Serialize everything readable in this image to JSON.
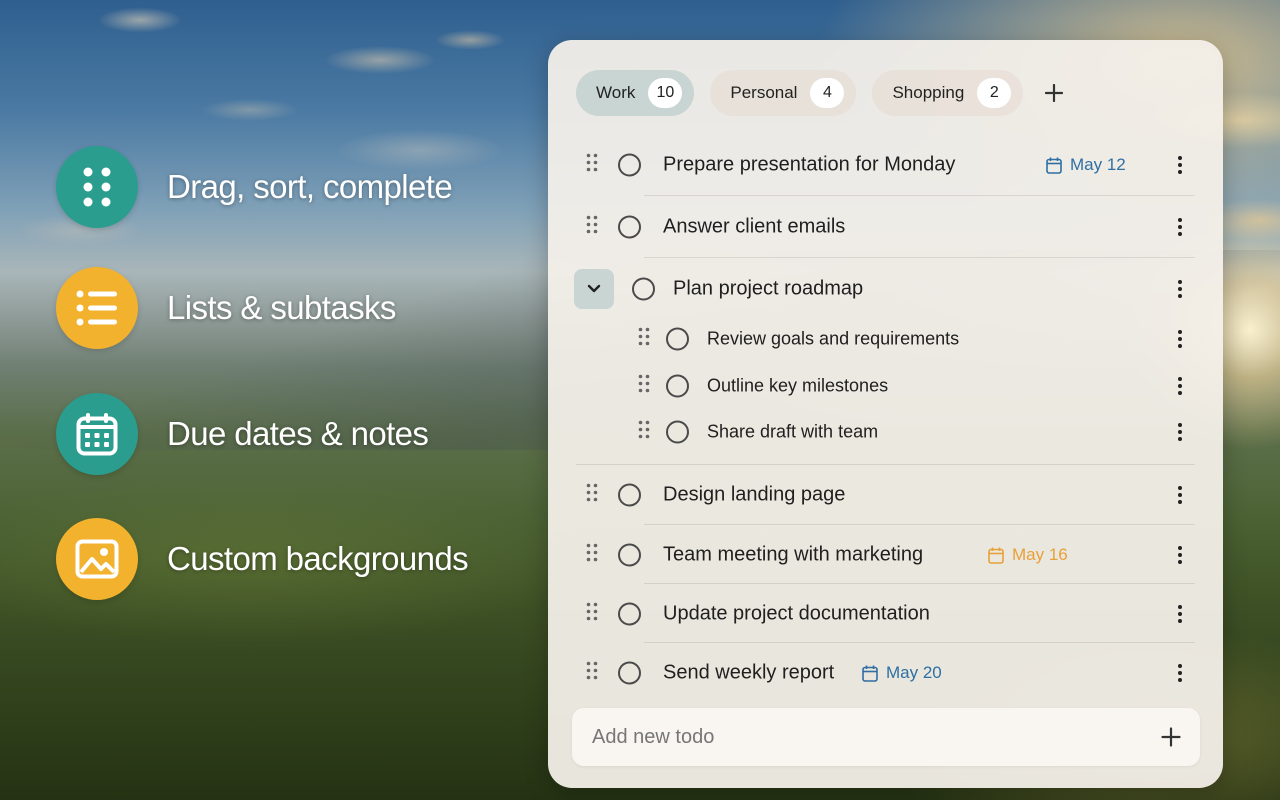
{
  "features": [
    {
      "label": "Drag, sort, complete",
      "icon": "drag-dots-icon",
      "color": "#2a9d8f"
    },
    {
      "label": "Lists & subtasks",
      "icon": "list-icon",
      "color": "#f2b22e"
    },
    {
      "label": "Due dates & notes",
      "icon": "calendar-icon",
      "color": "#2a9d8f"
    },
    {
      "label": "Custom backgrounds",
      "icon": "image-icon",
      "color": "#f2b22e"
    }
  ],
  "tabs": [
    {
      "label": "Work",
      "count": "10",
      "active": true
    },
    {
      "label": "Personal",
      "count": "4",
      "active": false
    },
    {
      "label": "Shopping",
      "count": "2",
      "active": false
    }
  ],
  "tasks": [
    {
      "text": "Prepare presentation for Monday",
      "date": "May 12",
      "date_color": "#2f6fa3"
    },
    {
      "text": "Answer client emails"
    },
    {
      "text": "Plan project roadmap",
      "expanded": true
    },
    {
      "text": "Review goals and requirements",
      "subtask": true
    },
    {
      "text": "Outline key milestones",
      "subtask": true
    },
    {
      "text": "Share draft with team",
      "subtask": true
    },
    {
      "text": "Design landing page"
    },
    {
      "text": "Team meeting with marketing",
      "date": "May 16",
      "date_color": "#e8a13a"
    },
    {
      "text": "Update project documentation"
    },
    {
      "text": "Send weekly report",
      "date": "May 20",
      "date_color": "#2f6fa3"
    }
  ],
  "add_todo": {
    "placeholder": "Add new todo",
    "value": ""
  },
  "colors": {
    "accent_teal": "#2a9d8f",
    "accent_amber": "#f2b22e",
    "active_tab": "#c9d5d3",
    "date_blue": "#2f6fa3",
    "date_orange": "#e8a13a"
  }
}
